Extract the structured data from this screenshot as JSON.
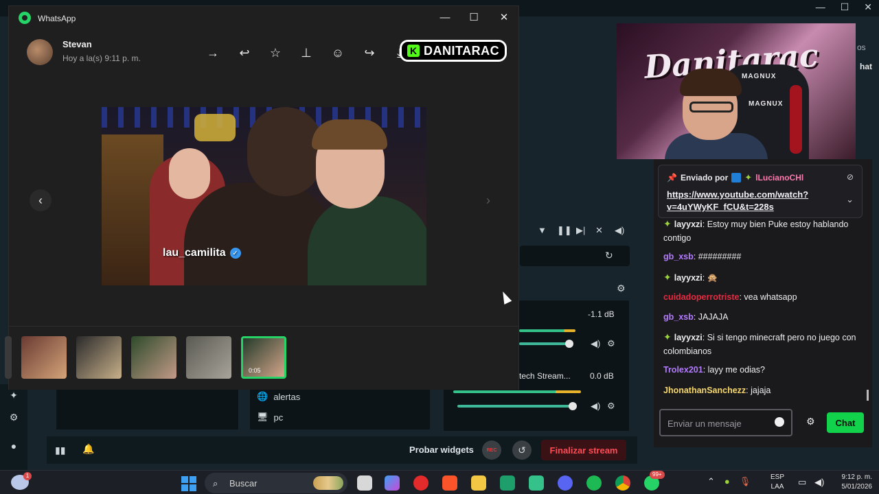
{
  "whatsapp": {
    "title": "WhatsApp",
    "contact_name": "Stevan",
    "contact_time": "Hoy a la(s) 9:11 p. m.",
    "overlay_logo_k": "K",
    "overlay_logo_text": "DANITARAC",
    "image_tag": "lau_camilita",
    "thumb_duration": "0:05",
    "icons": [
      "forward-icon",
      "reply-icon",
      "star-icon",
      "pin-icon",
      "emoji-icon",
      "share-icon",
      "download-icon"
    ]
  },
  "webcam": {
    "graffiti": "Danitarac",
    "chair_brand_top": "MAGNUX",
    "chair_brand_mid": "MAGNUX"
  },
  "right_peek": {
    "line1": "os",
    "line2": "hat"
  },
  "chat": {
    "pinned": {
      "label": "Enviado por",
      "user": "lLucianoCHl",
      "link": "https://www.youtube.com/watch?v=4uYWyKF_fCU&t=228s"
    },
    "messages": [
      {
        "user": "layyxzi",
        "color": "#efeff1",
        "badge": true,
        "text": ": Estoy muy bien Puke estoy hablando contigo"
      },
      {
        "user": "gb_xsb",
        "color": "#b37bff",
        "badge": false,
        "text": ": #########"
      },
      {
        "user": "layyxzi",
        "color": "#efeff1",
        "badge": true,
        "text": ": 🙊"
      },
      {
        "user": "cuidadoperrotriste",
        "color": "#e8293f",
        "badge": false,
        "text": ": vea whatsapp"
      },
      {
        "user": "gb_xsb",
        "color": "#b37bff",
        "badge": false,
        "text": ": JAJAJA"
      },
      {
        "user": "layyxzi",
        "color": "#efeff1",
        "badge": true,
        "text": ": Si si tengo minecraft pero no juego con colombianos"
      },
      {
        "user": "Trolex201",
        "color": "#b37bff",
        "badge": false,
        "text": ": layy me odias?"
      },
      {
        "user": "JhonathanSanchezz",
        "color": "#f5d76e",
        "badge": false,
        "text": ": jajaja"
      }
    ],
    "input_placeholder": "Enviar un mensaje",
    "send_label": "Chat"
  },
  "mixer": {
    "db1": "-1.1 dB",
    "source_label": "tech Stream...",
    "db2": "0.0 dB"
  },
  "sources": [
    "alertas",
    "pc"
  ],
  "bottom": {
    "probar": "Probar widgets",
    "rec": "REC",
    "finalizar": "Finalizar stream"
  },
  "taskbar": {
    "search": "Buscar",
    "notif_badge": "99+",
    "weather_badge": "1",
    "lang1": "ESP",
    "lang2": "LAA",
    "time": "9:12 p. m.",
    "date": "5/01/2026"
  },
  "colors": {
    "whatsapp_green": "#25d366",
    "kick_green": "#53fc18",
    "chat_button": "#12d14a",
    "finalizar_red": "#ff4b55"
  }
}
